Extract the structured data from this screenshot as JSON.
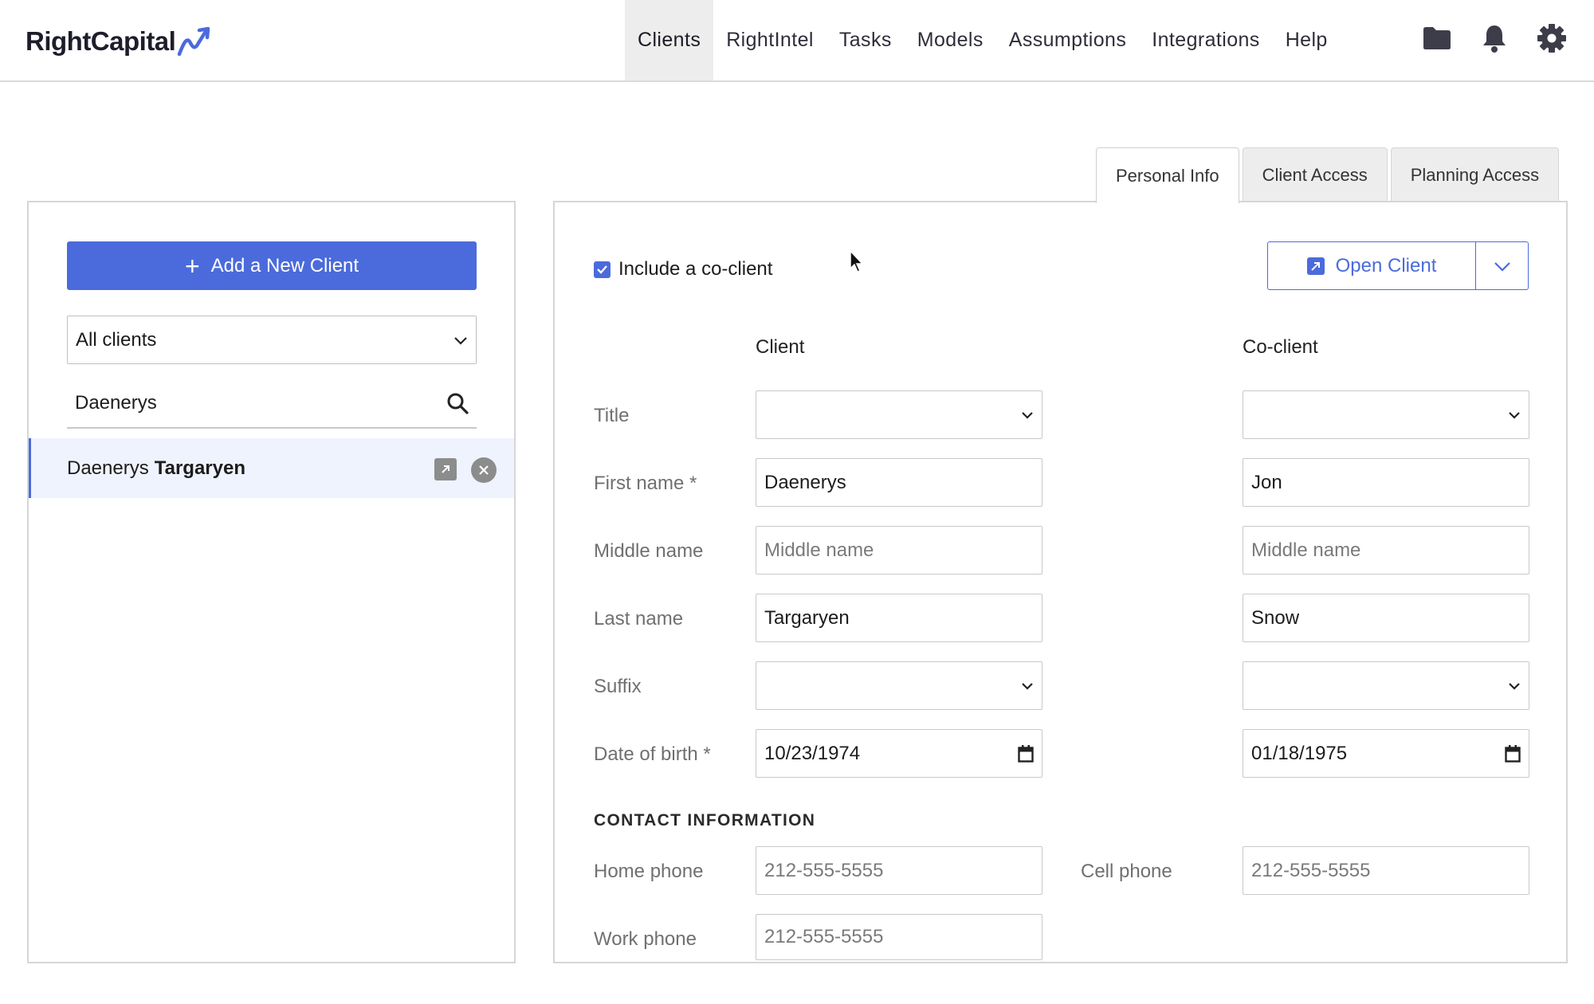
{
  "brand": {
    "name": "RightCapital",
    "accent": "#4b6bdc"
  },
  "nav": {
    "items": [
      "Clients",
      "RightIntel",
      "Tasks",
      "Models",
      "Assumptions",
      "Integrations",
      "Help"
    ],
    "active": "Clients",
    "icons": [
      "folder-icon",
      "bell-icon",
      "gear-icon"
    ]
  },
  "tabs": [
    "Personal Info",
    "Client Access",
    "Planning Access"
  ],
  "left": {
    "add_button": "Add a New Client",
    "filter": "All clients",
    "search_value": "Daenerys",
    "results": [
      {
        "first": "Daenerys",
        "last": "Targaryen"
      }
    ]
  },
  "form": {
    "include_coclient_label": "Include a co-client",
    "include_coclient_checked": true,
    "open_client_label": "Open Client",
    "col_client": "Client",
    "col_coclient": "Co-client",
    "labels": {
      "title": "Title",
      "first_name": "First name *",
      "middle_name": "Middle name",
      "last_name": "Last name",
      "suffix": "Suffix",
      "dob": "Date of birth *"
    },
    "client": {
      "title": "",
      "first_name": "Daenerys",
      "middle_name_placeholder": "Middle name",
      "last_name": "Targaryen",
      "suffix": "",
      "dob": "10/23/1974"
    },
    "coclient": {
      "title": "",
      "first_name": "Jon",
      "middle_name_placeholder": "Middle name",
      "last_name": "Snow",
      "suffix": "",
      "dob": "01/18/1975"
    },
    "contact": {
      "heading": "CONTACT INFORMATION",
      "home_phone_label": "Home phone",
      "home_phone_placeholder": "212-555-5555",
      "cell_phone_label": "Cell phone",
      "cell_phone_placeholder": "212-555-5555",
      "work_phone_label": "Work phone",
      "work_phone_placeholder": "212-555-5555"
    }
  }
}
